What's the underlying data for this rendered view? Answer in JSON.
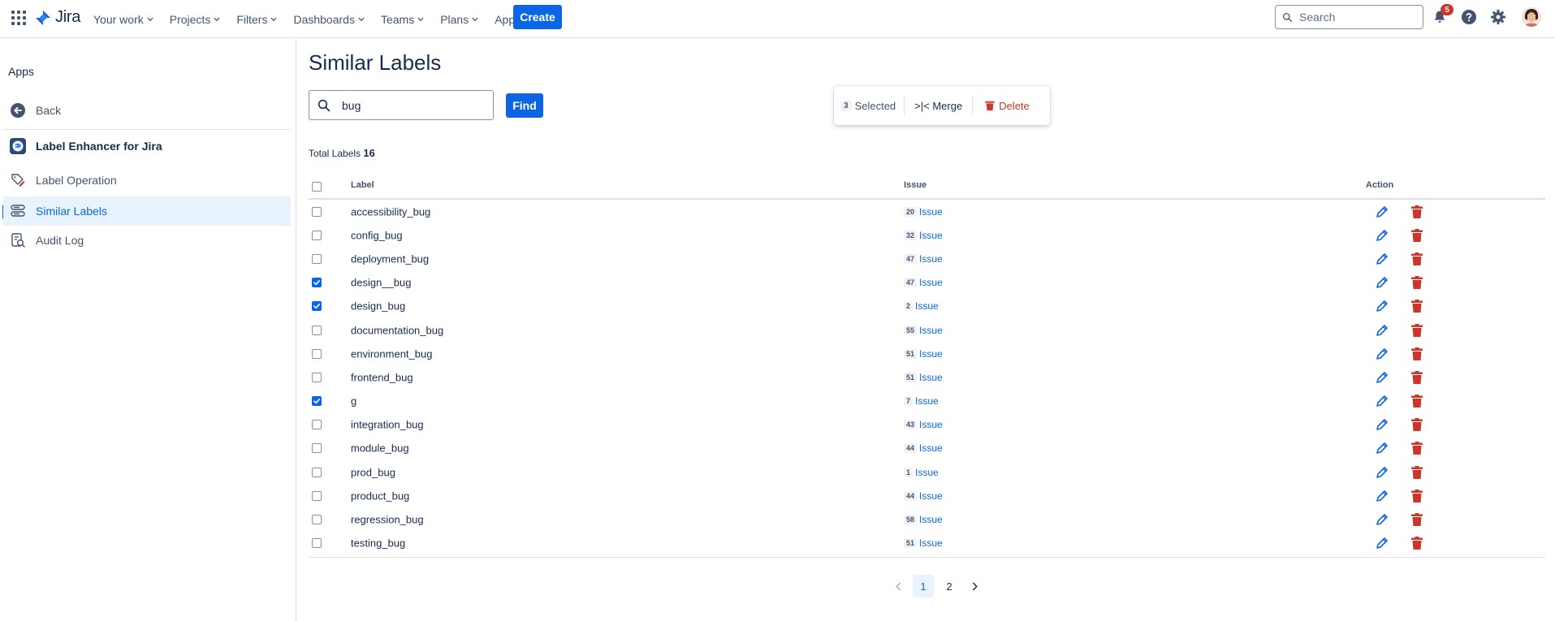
{
  "topnav": {
    "product": "Jira",
    "items": [
      {
        "label": "Your work"
      },
      {
        "label": "Projects"
      },
      {
        "label": "Filters"
      },
      {
        "label": "Dashboards"
      },
      {
        "label": "Teams"
      },
      {
        "label": "Plans"
      },
      {
        "label": "Apps"
      }
    ],
    "create_label": "Create",
    "search_placeholder": "Search",
    "notification_count": "5",
    "accent": "#0c66e4"
  },
  "sidebar": {
    "title": "Apps",
    "back_label": "Back",
    "app_name": "Label Enhancer for Jira",
    "items": [
      {
        "label": "Label Operation",
        "icon": "tag-pen-icon"
      },
      {
        "label": "Similar Labels",
        "icon": "similar-labels-icon",
        "active": true
      },
      {
        "label": "Audit Log",
        "icon": "audit-log-icon"
      }
    ]
  },
  "main": {
    "title": "Similar Labels",
    "search_value": "bug",
    "find_label": "Find",
    "selection": {
      "count": "3",
      "selected_label": "Selected",
      "merge_label": ">|< Merge",
      "delete_label": "Delete"
    },
    "total_label": "Total Labels",
    "total_count": "16",
    "columns": {
      "label": "Label",
      "issue": "Issue",
      "action": "Action"
    },
    "rows": [
      {
        "label": "accessibility_bug",
        "count": "20",
        "issue": "Issue",
        "checked": false
      },
      {
        "label": "config_bug",
        "count": "32",
        "issue": "Issue",
        "checked": false
      },
      {
        "label": "deployment_bug",
        "count": "47",
        "issue": "Issue",
        "checked": false
      },
      {
        "label": "design__bug",
        "count": "47",
        "issue": "Issue",
        "checked": true
      },
      {
        "label": "design_bug",
        "count": "2",
        "issue": "Issue",
        "checked": true
      },
      {
        "label": "documentation_bug",
        "count": "55",
        "issue": "Issue",
        "checked": false
      },
      {
        "label": "environment_bug",
        "count": "51",
        "issue": "Issue",
        "checked": false
      },
      {
        "label": "frontend_bug",
        "count": "51",
        "issue": "Issue",
        "checked": false
      },
      {
        "label": "g",
        "count": "7",
        "issue": "Issue",
        "checked": true
      },
      {
        "label": "integration_bug",
        "count": "43",
        "issue": "Issue",
        "checked": false
      },
      {
        "label": "module_bug",
        "count": "44",
        "issue": "Issue",
        "checked": false
      },
      {
        "label": "prod_bug",
        "count": "1",
        "issue": "Issue",
        "checked": false
      },
      {
        "label": "product_bug",
        "count": "44",
        "issue": "Issue",
        "checked": false
      },
      {
        "label": "regression_bug",
        "count": "58",
        "issue": "Issue",
        "checked": false
      },
      {
        "label": "testing_bug",
        "count": "51",
        "issue": "Issue",
        "checked": false
      }
    ],
    "pagination": {
      "pages": [
        "1",
        "2"
      ],
      "current": "1"
    },
    "danger_color": "#c9372c"
  }
}
